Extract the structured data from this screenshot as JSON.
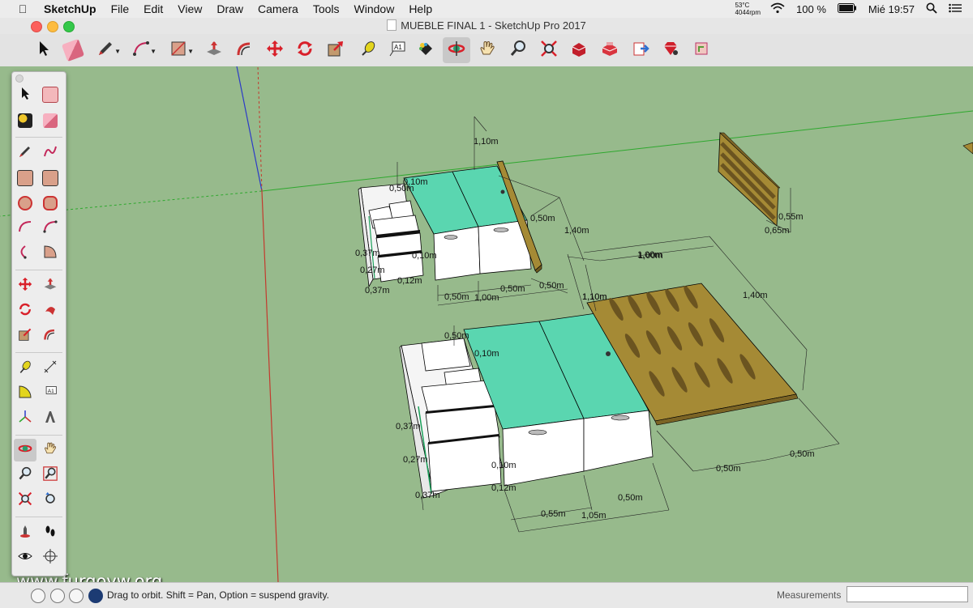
{
  "menubar": {
    "apple_icon": "apple-icon",
    "items": [
      "SketchUp",
      "File",
      "Edit",
      "View",
      "Draw",
      "Camera",
      "Tools",
      "Window",
      "Help"
    ],
    "temperature": "53°C",
    "fan": "4044rpm",
    "battery": "100 %",
    "clock": "Mié 19:57"
  },
  "window": {
    "title": "MUEBLE FINAL 1 - SketchUp Pro 2017",
    "controls": [
      "close",
      "minimize",
      "zoom"
    ]
  },
  "toolbar": {
    "tools": [
      "select",
      "eraser",
      "pencil",
      "arc",
      "rectangle",
      "push-pull",
      "offset",
      "move",
      "rotate",
      "scale",
      "tape-measure",
      "text",
      "paint-bucket",
      "orbit",
      "pan",
      "zoom",
      "zoom-extents",
      "3d-warehouse",
      "extension-warehouse",
      "send-to-layout",
      "extension-manager",
      "ruby",
      "component-tray"
    ],
    "active_tool": "orbit"
  },
  "palette": {
    "tools": [
      "select",
      "make-component",
      "paint-bucket",
      "eraser",
      "line",
      "freehand",
      "rectangle",
      "rotated-rectangle",
      "circle",
      "polygon",
      "arc",
      "two-point-arc",
      "three-point-arc",
      "pie",
      "move",
      "push-pull",
      "rotate",
      "follow-me",
      "scale",
      "offset",
      "tape-measure",
      "dimension",
      "protractor",
      "text",
      "axes",
      "3d-text",
      "orbit",
      "pan",
      "zoom",
      "zoom-window",
      "zoom-extents",
      "previous-view",
      "position-camera",
      "walk",
      "look-around",
      "section-plane"
    ],
    "active_tool": "orbit"
  },
  "model": {
    "dimensions_top": [
      "1,10m",
      "0,50m",
      "1,10m",
      "1,40m",
      "0,50m",
      "1,00m",
      "0,50m",
      "0,50m",
      "0,50m",
      "0,37m",
      "0,27m",
      "0,37m",
      "0,12m",
      "0,10m",
      "1,00m"
    ],
    "dimensions_bottom": [
      "1,00m",
      "1,10m",
      "1,40m",
      "0,50m",
      "0,10m",
      "0,37m",
      "0,27m",
      "0,37m",
      "0,10m",
      "0,12m",
      "0,55m",
      "1,05m",
      "0,50m",
      "0,50m",
      "0,50m"
    ],
    "dimensions_panel": [
      "0,55m",
      "0,65m"
    ]
  },
  "watermark": "www.furgovw.org",
  "statusbar": {
    "hint": "Drag to orbit. Shift = Pan, Option = suspend gravity.",
    "measurements_label": "Measurements",
    "measurements_value": ""
  },
  "colors": {
    "ground": "#97ba8c",
    "box_top": "#5ad6b0",
    "box_side": "#ffffff",
    "wood": "#a58a35",
    "axis_red": "#c33a2e",
    "axis_green": "#2ea82e",
    "axis_blue": "#2c3ac8",
    "active_tool": "#c8c8c8"
  }
}
